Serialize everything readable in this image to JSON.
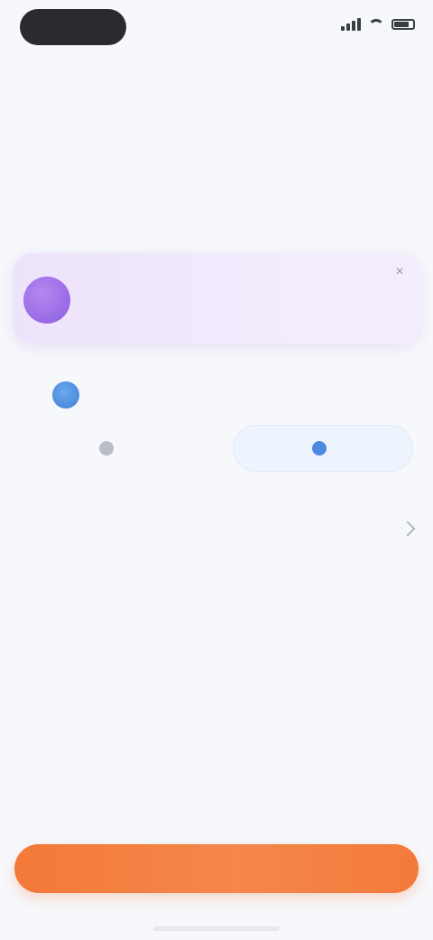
{
  "tabs": [
    {
      "label": "",
      "active": true
    },
    {
      "label": "",
      "active": false
    }
  ],
  "intro": {
    "title": "",
    "description": "",
    "link": ""
  },
  "ai_card": {
    "title": "",
    "message": ""
  },
  "contact": {
    "name": "",
    "subtitle": ""
  },
  "actions": {
    "secondary_label": "",
    "primary_label": ""
  },
  "section": {
    "title": ""
  },
  "cta": {
    "label": ""
  },
  "colors": {
    "accent_orange": "#f3793a",
    "ai_purple": "#8c5de0",
    "link_blue": "#3d8be0",
    "background": "#f7f8fb"
  },
  "icons": [
    "signal-icon",
    "wifi-icon",
    "battery-icon",
    "close-icon",
    "avatar",
    "phone-icon",
    "message-icon",
    "chevron-right-icon"
  ]
}
